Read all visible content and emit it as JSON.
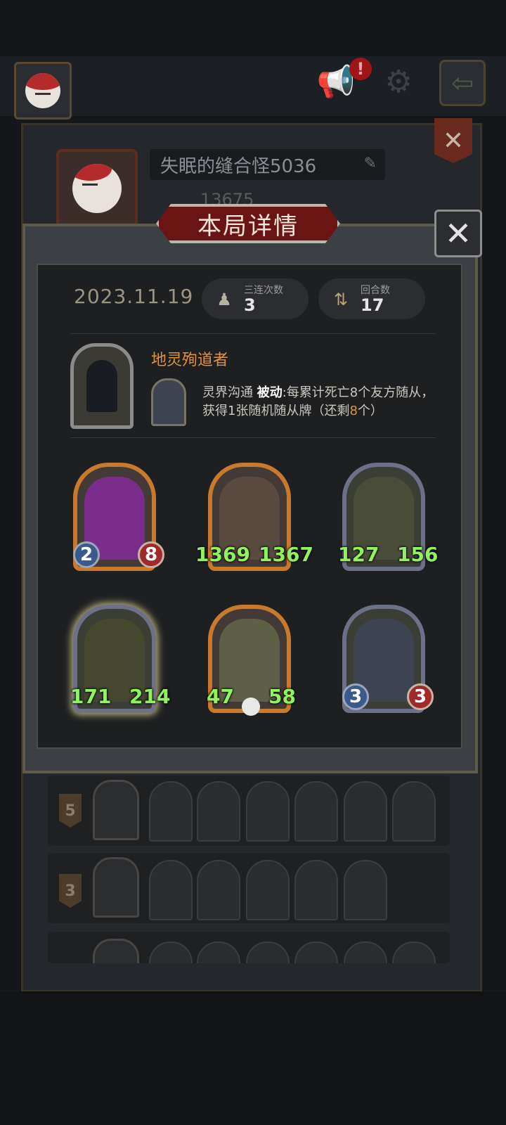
{
  "profile": {
    "name": "失眠的缝合怪5036",
    "score": "13675"
  },
  "dialog": {
    "title": "本局详情",
    "date": "2023.11.19",
    "triples": {
      "label": "三连次数",
      "value": "3"
    },
    "turns": {
      "label": "回合数",
      "value": "17"
    }
  },
  "hero": {
    "name": "地灵殉道者",
    "power_name": "灵界沟通",
    "power_type": "被动",
    "desc_part1": ":每累计死亡8个友方随从，获得1张随机随从牌（还剩",
    "remaining": "8",
    "desc_part2": "个）"
  },
  "minions": [
    {
      "attack": "2",
      "health": "8",
      "style": "gem"
    },
    {
      "attack": "1369",
      "health": "1367",
      "style": "text"
    },
    {
      "attack": "127",
      "health": "156",
      "style": "text"
    },
    {
      "attack": "171",
      "health": "214",
      "style": "text"
    },
    {
      "attack": "47",
      "health": "58",
      "style": "text"
    },
    {
      "attack": "3",
      "health": "3",
      "style": "gem"
    }
  ],
  "history": [
    {
      "tier": "5"
    },
    {
      "tier": "3"
    }
  ],
  "colors": {
    "accent_orange": "#e1933b",
    "stat_green": "#8ff25e",
    "banner_red": "#6b1414"
  },
  "icons": [
    "megaphone-icon",
    "gear-icon",
    "back-icon",
    "close-icon",
    "pencil-icon",
    "triple-icon",
    "turns-icon",
    "skull-icon"
  ]
}
